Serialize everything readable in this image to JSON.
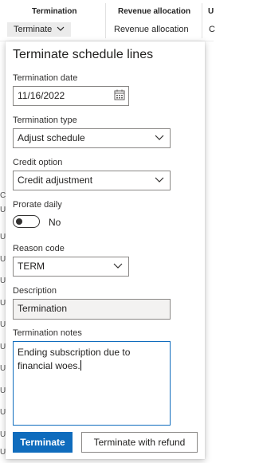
{
  "background": {
    "columns": [
      {
        "title": "Termination",
        "action": "Terminate"
      },
      {
        "title": "Revenue allocation",
        "action": "Revenue allocation"
      },
      {
        "title": "U",
        "action": "C"
      }
    ],
    "row_fragments": [
      "Cu",
      "U",
      "US",
      "US",
      "US",
      "US",
      "US",
      "US",
      "US",
      "US",
      "US",
      "US",
      "US"
    ]
  },
  "dialog": {
    "title": "Terminate schedule lines",
    "termination_date": {
      "label": "Termination date",
      "value": "11/16/2022"
    },
    "termination_type": {
      "label": "Termination type",
      "value": "Adjust schedule"
    },
    "credit_option": {
      "label": "Credit option",
      "value": "Credit adjustment"
    },
    "prorate_daily": {
      "label": "Prorate daily",
      "value_text": "No"
    },
    "reason_code": {
      "label": "Reason code",
      "value": "TERM"
    },
    "description": {
      "label": "Description",
      "value": "Termination"
    },
    "termination_notes": {
      "label": "Termination notes",
      "value": "Ending subscription due to financial woes."
    },
    "buttons": {
      "terminate": "Terminate",
      "terminate_with_refund": "Terminate with refund"
    }
  },
  "colors": {
    "accent": "#0f6cbd"
  }
}
